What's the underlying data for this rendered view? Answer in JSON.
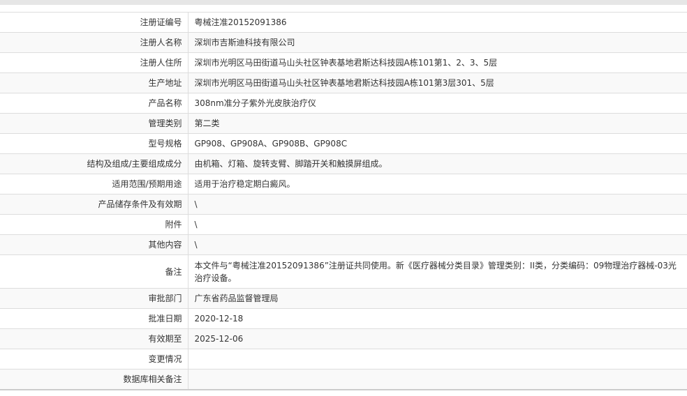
{
  "record": {
    "rows": [
      {
        "label": "注册证编号",
        "value": "粤械注准20152091386"
      },
      {
        "label": "注册人名称",
        "value": "深圳市吉斯迪科技有限公司"
      },
      {
        "label": "注册人住所",
        "value": "深圳市光明区马田街道马山头社区钟表基地君斯达科技园A栋101第1、2、3、5层"
      },
      {
        "label": "生产地址",
        "value": "深圳市光明区马田街道马山头社区钟表基地君斯达科技园A栋101第3层301、5层"
      },
      {
        "label": "产品名称",
        "value": "308nm准分子紫外光皮肤治疗仪"
      },
      {
        "label": "管理类别",
        "value": "第二类"
      },
      {
        "label": "型号规格",
        "value": "GP908、GP908A、GP908B、GP908C"
      },
      {
        "label": "结构及组成/主要组成成分",
        "value": "由机箱、灯箱、旋转支臂、脚踏开关和触摸屏组成。"
      },
      {
        "label": "适用范围/预期用途",
        "value": "适用于治疗稳定期白癜风。"
      },
      {
        "label": "产品储存条件及有效期",
        "value": "\\"
      },
      {
        "label": "附件",
        "value": "\\"
      },
      {
        "label": "其他内容",
        "value": "\\"
      },
      {
        "label": "备注",
        "value": "本文件与“粤械注准20152091386”注册证共同使用。新《医疗器械分类目录》管理类别：II类，分类编码：09物理治疗器械-03光治疗设备。"
      },
      {
        "label": "审批部门",
        "value": "广东省药品监督管理局"
      },
      {
        "label": "批准日期",
        "value": "2020-12-18"
      },
      {
        "label": "有效期至",
        "value": "2025-12-06"
      },
      {
        "label": "变更情况",
        "value": ""
      },
      {
        "label": "数据库相关备注",
        "value": ""
      }
    ]
  }
}
